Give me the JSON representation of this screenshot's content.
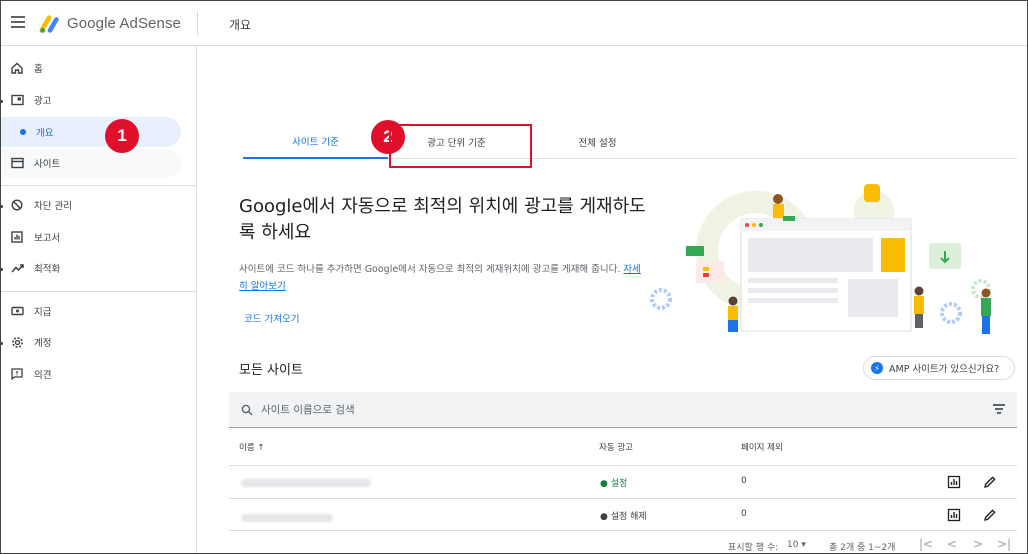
{
  "header": {
    "brand": "Google AdSense",
    "page_title": "개요"
  },
  "sidebar": {
    "items": [
      {
        "label": "홈",
        "icon": "home-icon"
      },
      {
        "label": "광고",
        "icon": "ads-icon"
      },
      {
        "label": "개요",
        "icon": "dot-icon"
      },
      {
        "label": "사이트",
        "icon": "sites-icon"
      },
      {
        "label": "차단 관리",
        "icon": "block-icon"
      },
      {
        "label": "보고서",
        "icon": "reports-icon"
      },
      {
        "label": "최적화",
        "icon": "optimize-icon"
      },
      {
        "label": "지급",
        "icon": "payments-icon"
      },
      {
        "label": "계정",
        "icon": "gear-icon"
      },
      {
        "label": "의견",
        "icon": "feedback-icon"
      }
    ]
  },
  "badges": {
    "one": "1",
    "two": "2"
  },
  "tabs": [
    {
      "label": "사이트 기준"
    },
    {
      "label": "광고 단위 기준"
    },
    {
      "label": "전체 설정"
    }
  ],
  "hero": {
    "title": "Google에서 자동으로 최적의 위치에 광고를 게재하도록 하세요",
    "desc": "사이트에 코드 하나를 추가하면 Google에서 자동으로 최적의 게재위치에 광고를 게재해 줍니다.",
    "learn_more": "자세히 알아보기",
    "code_link": "코드 가져오기"
  },
  "sites": {
    "title": "모든 사이트",
    "amp_chip": "AMP 사이트가 있으신가요?",
    "search_placeholder": "사이트 이름으로 검색",
    "columns": {
      "name": "이름 ↑",
      "auto_ads": "자동 광고",
      "page_exclusion": "페이지 제외"
    },
    "rows": [
      {
        "status": "설정",
        "exclusions": "0"
      },
      {
        "status": "설정 해제",
        "exclusions": "0"
      }
    ]
  },
  "footer": {
    "rows_per_page_label": "표시할 행 수:",
    "rows_per_page_value": "10 ▾",
    "range": "총 2개 중 1~2개"
  },
  "colors": {
    "accent": "#1a73e8",
    "badge": "#e0102a",
    "status_on": "#188038"
  }
}
